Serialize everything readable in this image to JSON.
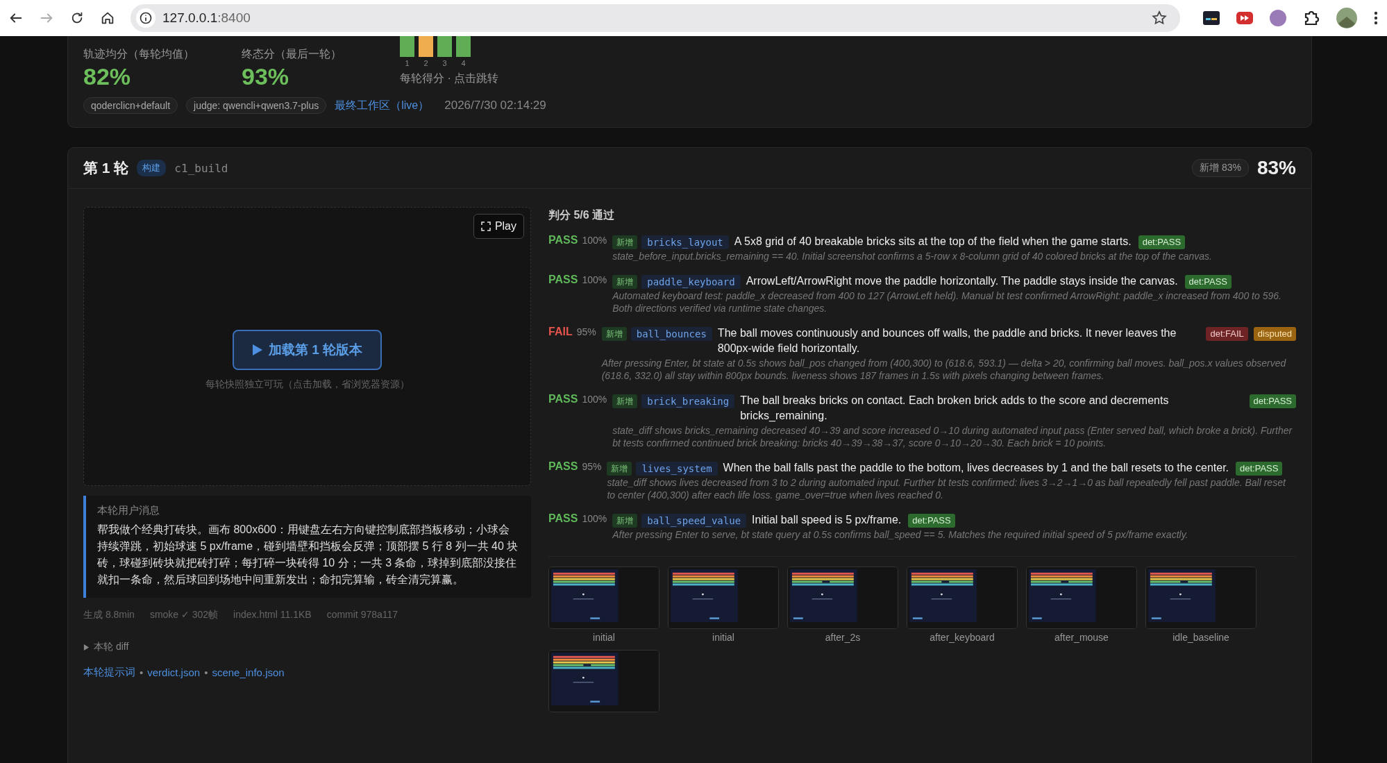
{
  "browser": {
    "url_host": "127.0.0.1",
    "url_port": ":8400",
    "forward_disabled": true
  },
  "summary": {
    "metrics": [
      {
        "label": "轨迹均分（每轮均值）",
        "value": "82%"
      },
      {
        "label": "终态分（最后一轮）",
        "value": "93%"
      }
    ],
    "bars": [
      {
        "label": "1",
        "color": "#5fae55"
      },
      {
        "label": "2",
        "color": "#f0ad4e"
      },
      {
        "label": "3",
        "color": "#5fae55"
      },
      {
        "label": "4",
        "color": "#5fae55"
      }
    ],
    "bars_caption": "每轮得分 · 点击跳转",
    "chips": [
      "qoderclicn+default",
      "judge: qwencli+qwen3.7-plus"
    ],
    "workspace_link": "最终工作区（live）",
    "timestamp": "2026/7/30 02:14:29"
  },
  "round": {
    "title": "第 1 轮",
    "tag": "构建",
    "id": "c1_build",
    "delta_chip": "新增 83%",
    "score": "83%",
    "play_button": "Play",
    "load_button": "加载第 1 轮版本",
    "load_hint": "每轮快照独立可玩（点击加载，省浏览器资源）",
    "message": {
      "title": "本轮用户消息",
      "body": "帮我做个经典打砖块。画布 800x600：用键盘左右方向键控制底部挡板移动；小球会持续弹跳，初始球速 5 px/frame，碰到墙壁和挡板会反弹；顶部摆 5 行 8 列一共 40 块砖，球碰到砖块就把砖打碎；每打碎一块砖得 10 分；一共 3 条命，球掉到底部没接住就扣一条命，然后球回到场地中间重新发出；命扣完算输，砖全清完算赢。"
    },
    "meta": [
      "生成 8.8min",
      "smoke ✓ 302帧",
      "index.html 11.1KB",
      "commit 978a117"
    ],
    "diff_toggle": {
      "label": "本轮 diff",
      "expanded": false
    },
    "links": [
      "本轮提示词",
      "verdict.json",
      "scene_info.json"
    ],
    "link_separator": "•",
    "verdict": {
      "heading": "判分 5/6 通过",
      "items": [
        {
          "result": "PASS",
          "kind": "pass",
          "confidence": "100%",
          "tag": "新增",
          "key": "bricks_layout",
          "claim": "A 5x8 grid of 40 breakable bricks sits at the top of the field when the game starts.",
          "badges": [
            {
              "text": "det:PASS",
              "kind": "pass"
            }
          ],
          "evidence": "state_before_input.bricks_remaining == 40. Initial screenshot confirms a 5-row x 8-column grid of 40 colored bricks at the top of the canvas."
        },
        {
          "result": "PASS",
          "kind": "pass",
          "confidence": "100%",
          "tag": "新增",
          "key": "paddle_keyboard",
          "claim": "ArrowLeft/ArrowRight move the paddle horizontally. The paddle stays inside the canvas.",
          "badges": [
            {
              "text": "det:PASS",
              "kind": "pass"
            }
          ],
          "evidence": "Automated keyboard test: paddle_x decreased from 400 to 127 (ArrowLeft held). Manual bt test confirmed ArrowRight: paddle_x increased from 400 to 596. Both directions verified via runtime state changes."
        },
        {
          "result": "FAIL",
          "kind": "fail",
          "confidence": "95%",
          "tag": "新增",
          "key": "ball_bounces",
          "claim": "The ball moves continuously and bounces off walls, the paddle and bricks. It never leaves the 800px-wide field horizontally.",
          "badges": [
            {
              "text": "det:FAIL",
              "kind": "fail"
            },
            {
              "text": "disputed",
              "kind": "disputed"
            }
          ],
          "evidence": "After pressing Enter, bt state at 0.5s shows ball_pos changed from (400,300) to (618.6, 593.1) — delta > 20, confirming ball moves. ball_pos.x values observed (618.6, 332.0) all stay within 800px bounds. liveness shows 187 frames in 1.5s with pixels changing between frames."
        },
        {
          "result": "PASS",
          "kind": "pass",
          "confidence": "100%",
          "tag": "新增",
          "key": "brick_breaking",
          "claim": "The ball breaks bricks on contact. Each broken brick adds to the score and decrements bricks_remaining.",
          "badges": [
            {
              "text": "det:PASS",
              "kind": "pass"
            }
          ],
          "evidence": "state_diff shows bricks_remaining decreased 40→39 and score increased 0→10 during automated input pass (Enter served ball, which broke a brick). Further bt tests confirmed continued brick breaking: bricks 40→39→38→37, score 0→10→20→30. Each brick = 10 points."
        },
        {
          "result": "PASS",
          "kind": "pass",
          "confidence": "95%",
          "tag": "新增",
          "key": "lives_system",
          "claim": "When the ball falls past the paddle to the bottom, lives decreases by 1 and the ball resets to the center.",
          "badges": [
            {
              "text": "det:PASS",
              "kind": "pass"
            }
          ],
          "evidence": "state_diff shows lives decreased from 3 to 2 during automated input. Further bt tests confirmed: lives 3→2→1→0 as ball repeatedly fell past paddle. Ball reset to center (400,300) after each life loss. game_over=true when lives reached 0."
        },
        {
          "result": "PASS",
          "kind": "pass",
          "confidence": "100%",
          "tag": "新增",
          "key": "ball_speed_value",
          "claim": "Initial ball speed is 5 px/frame.",
          "badges": [
            {
              "text": "det:PASS",
              "kind": "pass"
            }
          ],
          "evidence": "After pressing Enter to serve, bt state query at 0.5s confirms ball_speed == 5. Matches the required initial speed of 5 px/frame exactly."
        }
      ]
    },
    "screenshots": [
      {
        "kind": "picture",
        "label": "initial"
      },
      {
        "kind": "picture",
        "label": "initial"
      },
      {
        "kind": "picture",
        "label": "after_2s"
      },
      {
        "kind": "picture",
        "label": "after_keyboard"
      },
      {
        "kind": "picture",
        "label": "after_mouse"
      },
      {
        "kind": "picture",
        "label": "idle_baseline"
      },
      {
        "kind": "picture"
      }
    ]
  }
}
